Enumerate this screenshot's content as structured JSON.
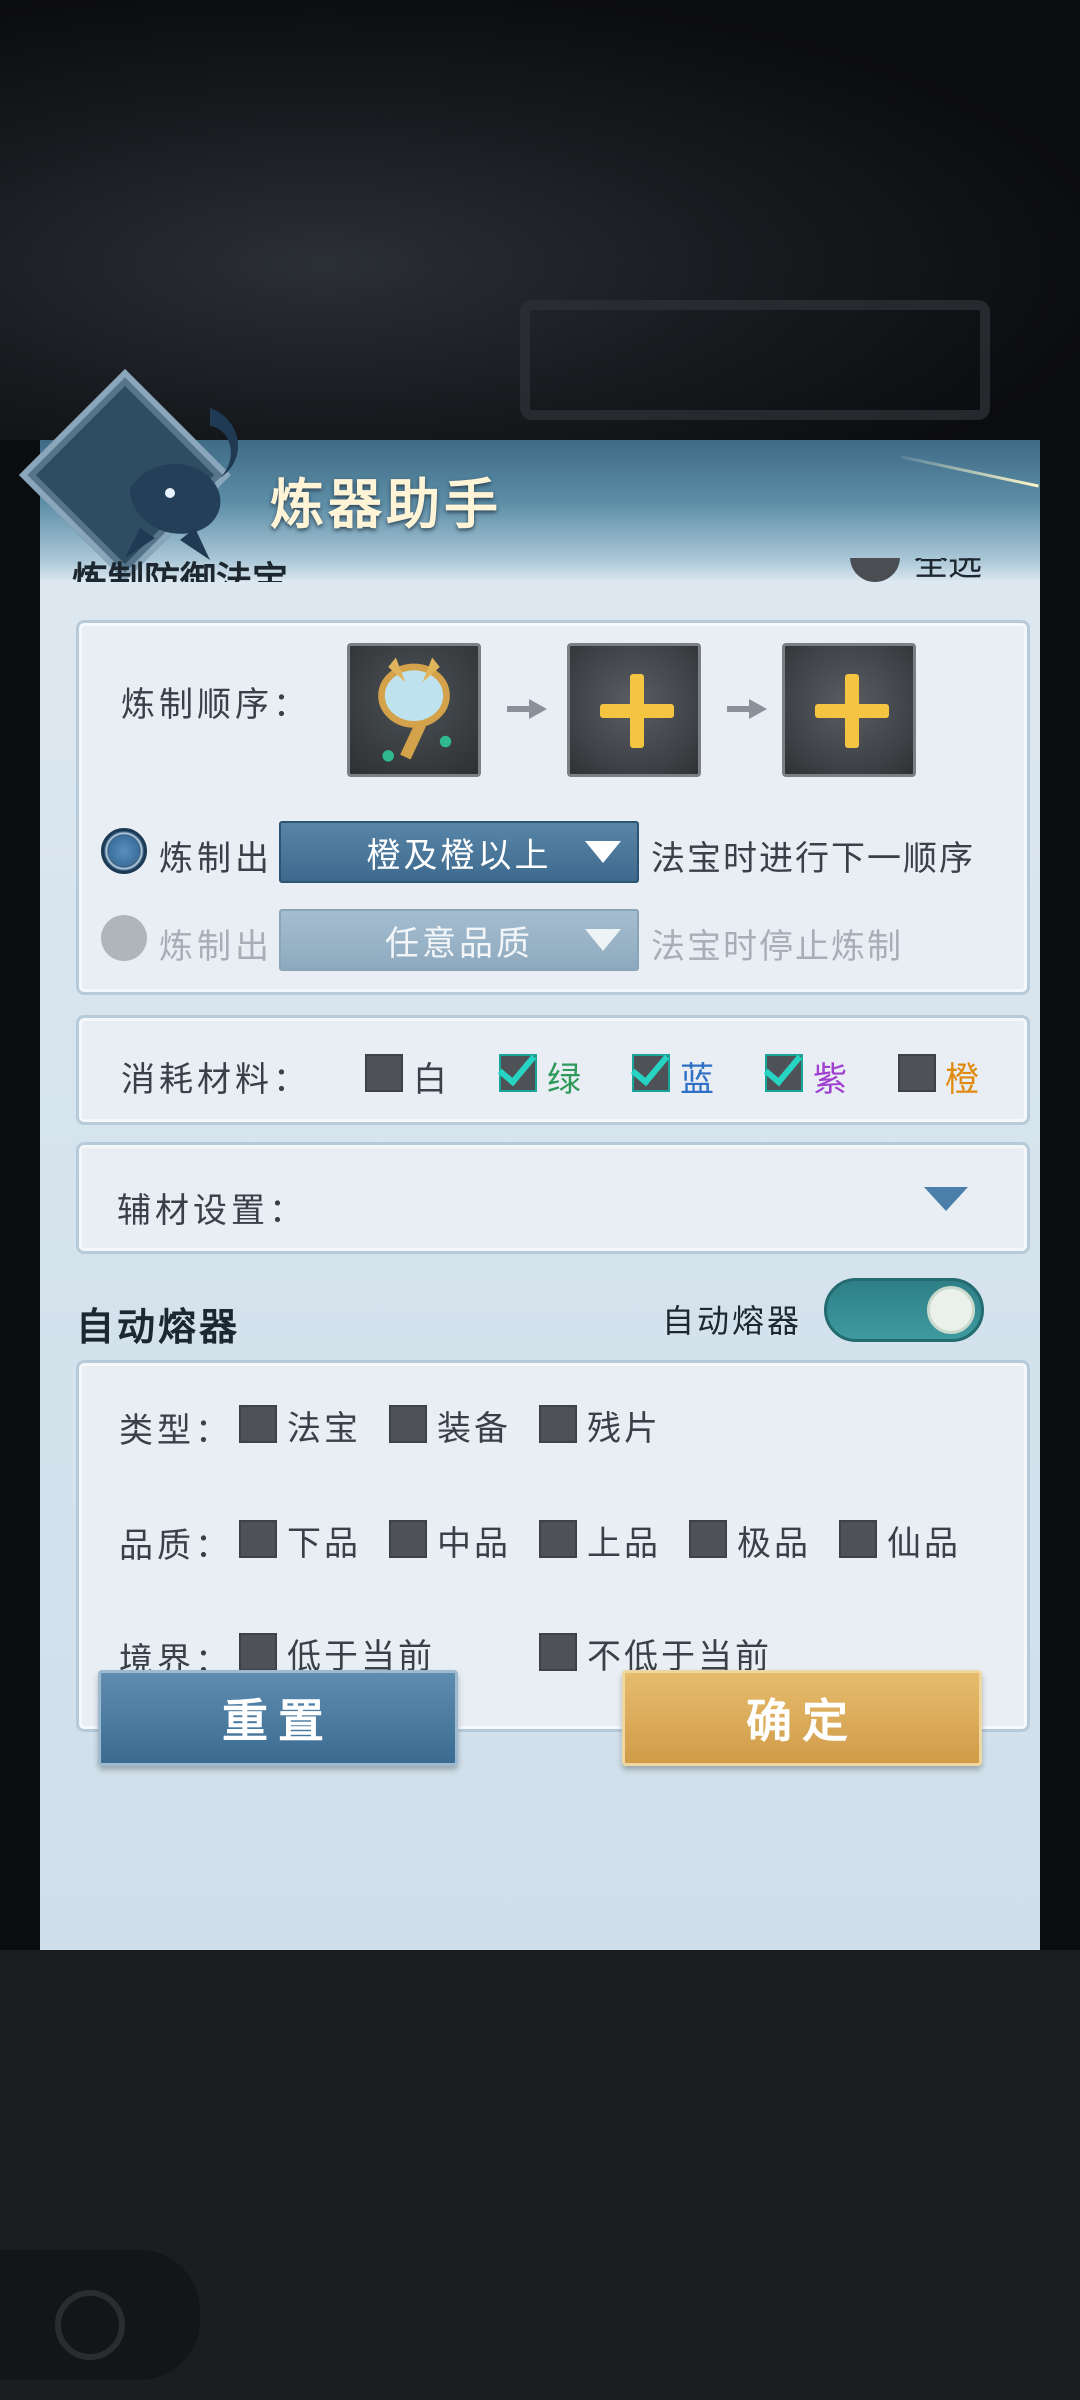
{
  "dialog": {
    "title": "炼器助手",
    "section_refine_partial": "炼制防御法宝",
    "select_all_partial": "全选"
  },
  "sequence": {
    "label": "炼制顺序：",
    "slots": [
      "artifact-item",
      "empty-add",
      "empty-add"
    ]
  },
  "refine_rules": [
    {
      "prefix": "炼制出",
      "dropdown": "橙及橙以上",
      "suffix": "法宝时进行下一顺序",
      "selected": true
    },
    {
      "prefix": "炼制出",
      "dropdown": "任意品质",
      "suffix": "法宝时停止炼制",
      "selected": false
    }
  ],
  "materials": {
    "label": "消耗材料：",
    "options": [
      {
        "label": "白",
        "checked": false,
        "color": "#3a4048"
      },
      {
        "label": "绿",
        "checked": true,
        "color": "#2f9a5a"
      },
      {
        "label": "蓝",
        "checked": true,
        "color": "#2f6fc4"
      },
      {
        "label": "紫",
        "checked": true,
        "color": "#a040d0"
      },
      {
        "label": "橙",
        "checked": false,
        "color": "#e08a10"
      }
    ]
  },
  "auxiliary": {
    "label": "辅材设置："
  },
  "auto_melt": {
    "title": "自动熔器",
    "toggle_label": "自动熔器",
    "toggle_on": true,
    "type": {
      "label": "类型：",
      "options": [
        "法宝",
        "装备",
        "残片"
      ]
    },
    "quality": {
      "label": "品质：",
      "options": [
        "下品",
        "中品",
        "上品",
        "极品",
        "仙品"
      ]
    },
    "realm": {
      "label": "境界：",
      "options": [
        "低于当前",
        "不低于当前"
      ]
    }
  },
  "buttons": {
    "reset": "重置",
    "confirm": "确定"
  },
  "colors": {
    "accent_blue": "#3d6a8e",
    "accent_gold": "#d09c49",
    "check": "#27d3c3"
  }
}
